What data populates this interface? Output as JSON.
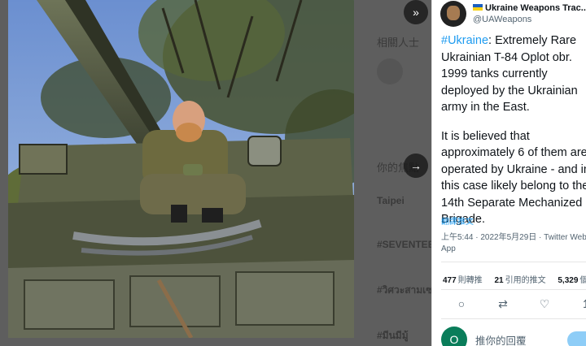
{
  "tweet": {
    "author_name": "Ukraine Weapons Trac...",
    "author_handle": "@UAWeapons",
    "hashtag": "#Ukraine",
    "lines": [
      ": Extremely Rare",
      "Ukrainian T-84 Oplot obr.",
      "1999 tanks currently",
      "deployed by the Ukrainian",
      "army in the East.",
      "",
      "It is believed that",
      "approximately 6 of them are",
      "operated by Ukraine - and in",
      "this case likely belong to the",
      "14th Separate Mechanized",
      "Brigade."
    ],
    "translate_label": "翻譯推文",
    "time": "上午5:44 · 2022年5月29日 · Twitter Web App",
    "retweets_count": "477",
    "retweets_label": "則轉推",
    "quotes_count": "21",
    "quotes_label": "引用的推文",
    "likes_count": "5,329",
    "likes_label": "個"
  },
  "reply": {
    "avatar_letter": "O",
    "placeholder": "推你的回覆"
  },
  "background": {
    "header": "相關人士",
    "trend_header": "你的焦點",
    "trend_location": "Taipei",
    "trend_1": "#SEVENTEEN",
    "trend_2": "#วิศวะสามเซน",
    "trend_3": "#มีนมีมู้"
  },
  "nav": {
    "collapse_icon": "collapse-icon",
    "next_icon": "arrow-right-icon"
  },
  "actions": [
    "reply-icon",
    "retweet-icon",
    "like-icon",
    "share-icon"
  ]
}
